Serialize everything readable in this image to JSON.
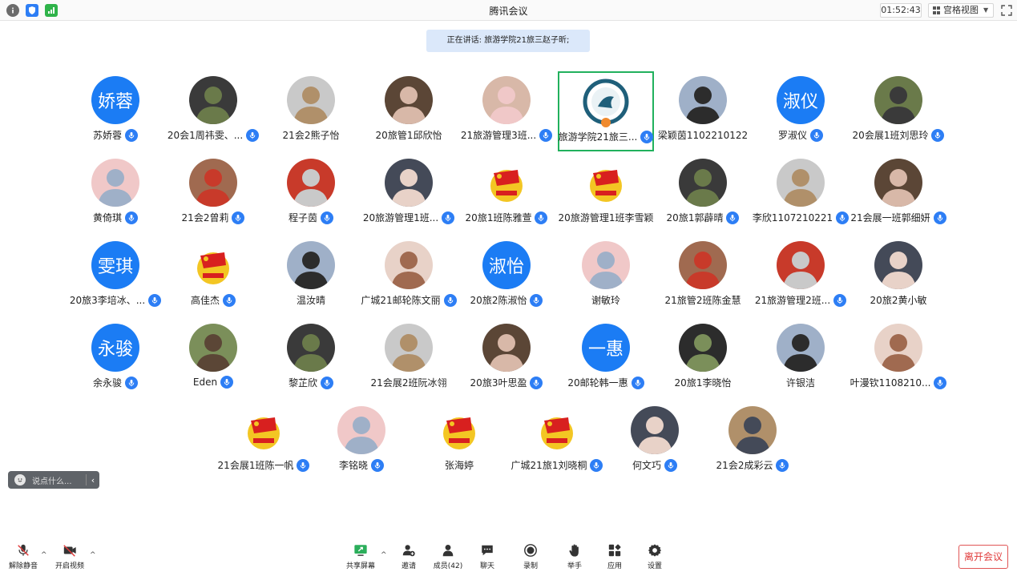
{
  "window": {
    "title": "腾讯会议",
    "timer": "01:52:43",
    "view_label": "宫格视图"
  },
  "speaking_banner": "正在讲话: 旅游学院21旅三赵子昕;",
  "participants": [
    {
      "name": "苏娇蓉",
      "avatar_text": "娇蓉",
      "mic": true
    },
    {
      "name": "20会1周祎雯、...",
      "mic": true
    },
    {
      "name": "21会2熊子怡",
      "mic": false
    },
    {
      "name": "20旅管1邱欣怡",
      "mic": false
    },
    {
      "name": "21旅游管理3班...",
      "mic": true
    },
    {
      "name": "旅游学院21旅三...",
      "mic": true,
      "active": true
    },
    {
      "name": "梁颖茵1102210122",
      "mic": false
    },
    {
      "name": "罗淑仪",
      "avatar_text": "淑仪",
      "mic": true
    },
    {
      "name": "20会展1班刘思玲",
      "mic": true
    },
    {
      "name": "黄倚琪",
      "mic": true
    },
    {
      "name": "21会2曾莉",
      "mic": true
    },
    {
      "name": "程子茵",
      "mic": true
    },
    {
      "name": "20旅游管理1班...",
      "mic": true
    },
    {
      "name": "20旅1班陈雅萱",
      "mic": true
    },
    {
      "name": "20旅游管理1班李雪颖",
      "mic": false
    },
    {
      "name": "20旅1郭薜晴",
      "mic": true
    },
    {
      "name": "李欣1107210221",
      "mic": true
    },
    {
      "name": "21会展一班郭细妍",
      "mic": true
    },
    {
      "name": "20旅3李培冰、...",
      "avatar_text": "雯琪",
      "mic": true
    },
    {
      "name": "高佳杰",
      "mic": true
    },
    {
      "name": "温汝晴",
      "mic": false
    },
    {
      "name": "广城21邮轮陈文丽",
      "mic": true
    },
    {
      "name": "20旅2陈淑怡",
      "avatar_text": "淑怡",
      "mic": true
    },
    {
      "name": "谢敏玲",
      "mic": false
    },
    {
      "name": "21旅管2班陈金慧",
      "mic": false
    },
    {
      "name": "21旅游管理2班...",
      "mic": true
    },
    {
      "name": "20旅2黄小敏",
      "mic": false
    },
    {
      "name": "余永骏",
      "avatar_text": "永骏",
      "mic": true
    },
    {
      "name": "Eden",
      "mic": true
    },
    {
      "name": "黎芷欣",
      "mic": true
    },
    {
      "name": "21会展2班阮冰翎",
      "mic": false
    },
    {
      "name": "20旅3叶思盈",
      "mic": true
    },
    {
      "name": "20邮轮韩一惠",
      "avatar_text": "一惠",
      "mic": true
    },
    {
      "name": "20旅1李晓怡",
      "mic": false
    },
    {
      "name": "许银洁",
      "mic": false
    },
    {
      "name": "叶漫钦1108210...",
      "mic": true
    },
    {
      "name": "21会展1班陈一帆",
      "mic": true
    },
    {
      "name": "李铭晓",
      "mic": true
    },
    {
      "name": "张海婷",
      "mic": false
    },
    {
      "name": "广城21旅1刘晓桐",
      "mic": true
    },
    {
      "name": "何文巧",
      "mic": true
    },
    {
      "name": "21会2成彩云",
      "mic": true
    }
  ],
  "chat": {
    "placeholder": "说点什么..."
  },
  "toolbar": {
    "unmute": "解除静音",
    "video": "开启视频",
    "share": "共享屏幕",
    "invite": "邀请",
    "members": "成员(42)",
    "chat": "聊天",
    "record": "录制",
    "raise_hand": "举手",
    "apps": "应用",
    "settings": "设置",
    "leave": "离开会议"
  },
  "colors": {
    "accent": "#2d7ef5",
    "active_border": "#21b15d",
    "leave": "#e03a3a",
    "banner_bg": "#dbe8fa"
  }
}
